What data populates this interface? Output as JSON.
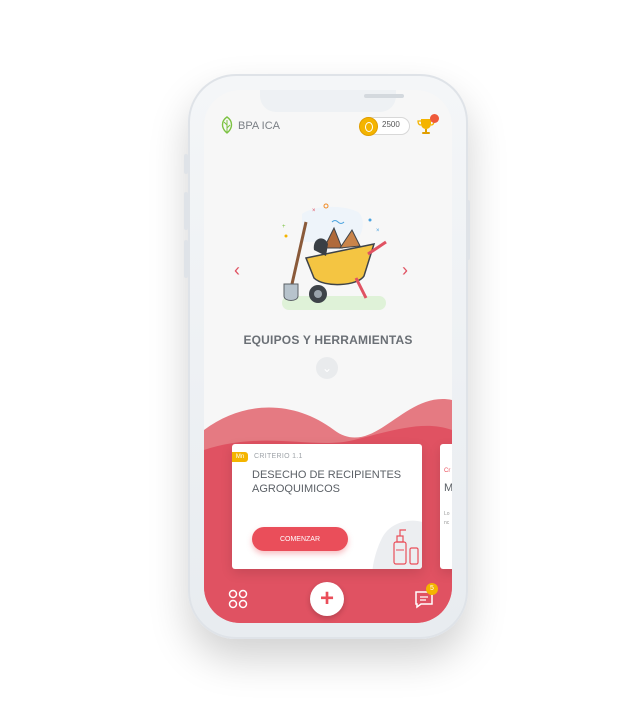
{
  "header": {
    "brand": "BPA ICA",
    "coins": "2500"
  },
  "carousel": {
    "title": "EQUIPOS Y HERRAMIENTAS",
    "prev": "‹",
    "next": "›",
    "expand": "⌄"
  },
  "card": {
    "badge": "Mn",
    "criterio": "CRITERIO 1.1",
    "title": "DESECHO DE RECIPIENTES AGROQUIMICOS",
    "button": "COMENZAR"
  },
  "card_next": {
    "label_a": "Cr",
    "label_b": "M",
    "label_c": "Lo nc"
  },
  "bottom_nav": {
    "fab": "+",
    "messages_badge": "5"
  },
  "colors": {
    "accent": "#ea4e5a",
    "wave": "#e05262",
    "coin": "#f4b400"
  }
}
